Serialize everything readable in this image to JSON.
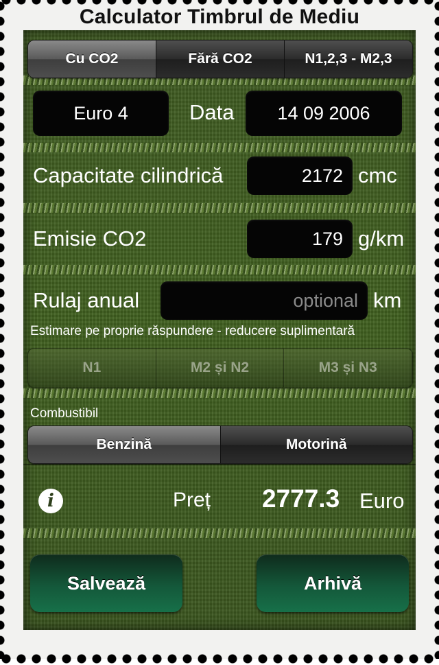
{
  "title": "Calculator Timbrul de Mediu",
  "mode_tabs": [
    {
      "label": "Cu CO2",
      "selected": true
    },
    {
      "label": "Fără CO2",
      "selected": false
    },
    {
      "label": "N1,2,3 - M2,3",
      "selected": false
    }
  ],
  "euro_norm": "Euro 4",
  "date_label": "Data",
  "date_value": "14 09 2006",
  "capacity": {
    "label": "Capacitate cilindrică",
    "value": "2172",
    "unit": "cmc"
  },
  "emission": {
    "label": "Emisie CO2",
    "value": "179",
    "unit": "g/km"
  },
  "mileage": {
    "label": "Rulaj anual",
    "placeholder": "optional",
    "unit": "km"
  },
  "estimate_note": "Estimare pe proprie răspundere - reducere suplimentară",
  "vehicle_class_tabs": [
    {
      "label": "N1"
    },
    {
      "label": "M2 și N2"
    },
    {
      "label": "M3 și N3"
    }
  ],
  "fuel": {
    "label": "Combustibil",
    "options": [
      {
        "label": "Benzină",
        "selected": false
      },
      {
        "label": "Motorină",
        "selected": true
      }
    ]
  },
  "price": {
    "label": "Preț",
    "value": "2777.3",
    "currency": "Euro"
  },
  "buttons": {
    "save": "Salvează",
    "archive": "Arhivă"
  },
  "icons": {
    "info": "info-icon"
  }
}
